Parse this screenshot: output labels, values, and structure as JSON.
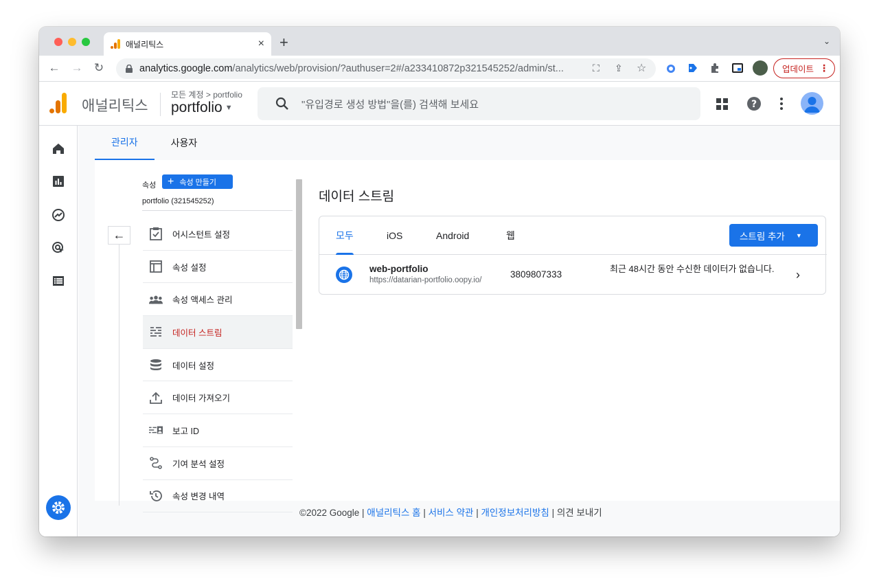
{
  "browser": {
    "tab_title": "애널리틱스",
    "url_host": "analytics.google.com",
    "url_path": "/analytics/web/provision/?authuser=2#/a233410872p321545252/admin/st...",
    "update_label": "업데이트"
  },
  "appbar": {
    "app_name": "애널리틱스",
    "breadcrumb_account": "모든 계정",
    "breadcrumb_sep": ">",
    "breadcrumb_property": "portfolio",
    "property_name": "portfolio",
    "search_placeholder": "\"유입경로 생성 방법\"을(를) 검색해 보세요"
  },
  "subtabs": {
    "admin": "관리자",
    "users": "사용자"
  },
  "property_panel": {
    "label": "속성",
    "create_button": "속성 만들기",
    "property_name": "portfolio (321545252)",
    "menu": [
      {
        "label": "어시스턴트 설정",
        "icon": "clipboard-check-icon"
      },
      {
        "label": "속성 설정",
        "icon": "layout-icon"
      },
      {
        "label": "속성 액세스 관리",
        "icon": "people-icon"
      },
      {
        "label": "데이터 스트림",
        "icon": "streams-icon"
      },
      {
        "label": "데이터 설정",
        "icon": "database-icon"
      },
      {
        "label": "데이터 가져오기",
        "icon": "upload-icon"
      },
      {
        "label": "보고 ID",
        "icon": "reporting-id-icon"
      },
      {
        "label": "기여 분석 설정",
        "icon": "attribution-icon"
      },
      {
        "label": "속성 변경 내역",
        "icon": "history-icon"
      }
    ]
  },
  "streams": {
    "title": "데이터 스트림",
    "tabs": [
      "모두",
      "iOS",
      "Android",
      "웹"
    ],
    "add_button": "스트림 추가",
    "rows": [
      {
        "name": "web-portfolio",
        "url": "https://datarian-portfolio.oopy.io/",
        "id": "3809807333",
        "status": "최근 48시간 동안 수신한 데이터가 없습니다."
      }
    ]
  },
  "footer": {
    "copyright": "©2022 Google",
    "sep": " | ",
    "link_home": "애널리틱스 홈",
    "link_terms": "서비스 약관",
    "link_privacy": "개인정보처리방침",
    "feedback": "의견 보내기"
  },
  "colors": {
    "accent": "#1a73e8",
    "active_menu": "#c5221f",
    "logo_orange": "#f9ab00",
    "logo_dark": "#e37400"
  }
}
